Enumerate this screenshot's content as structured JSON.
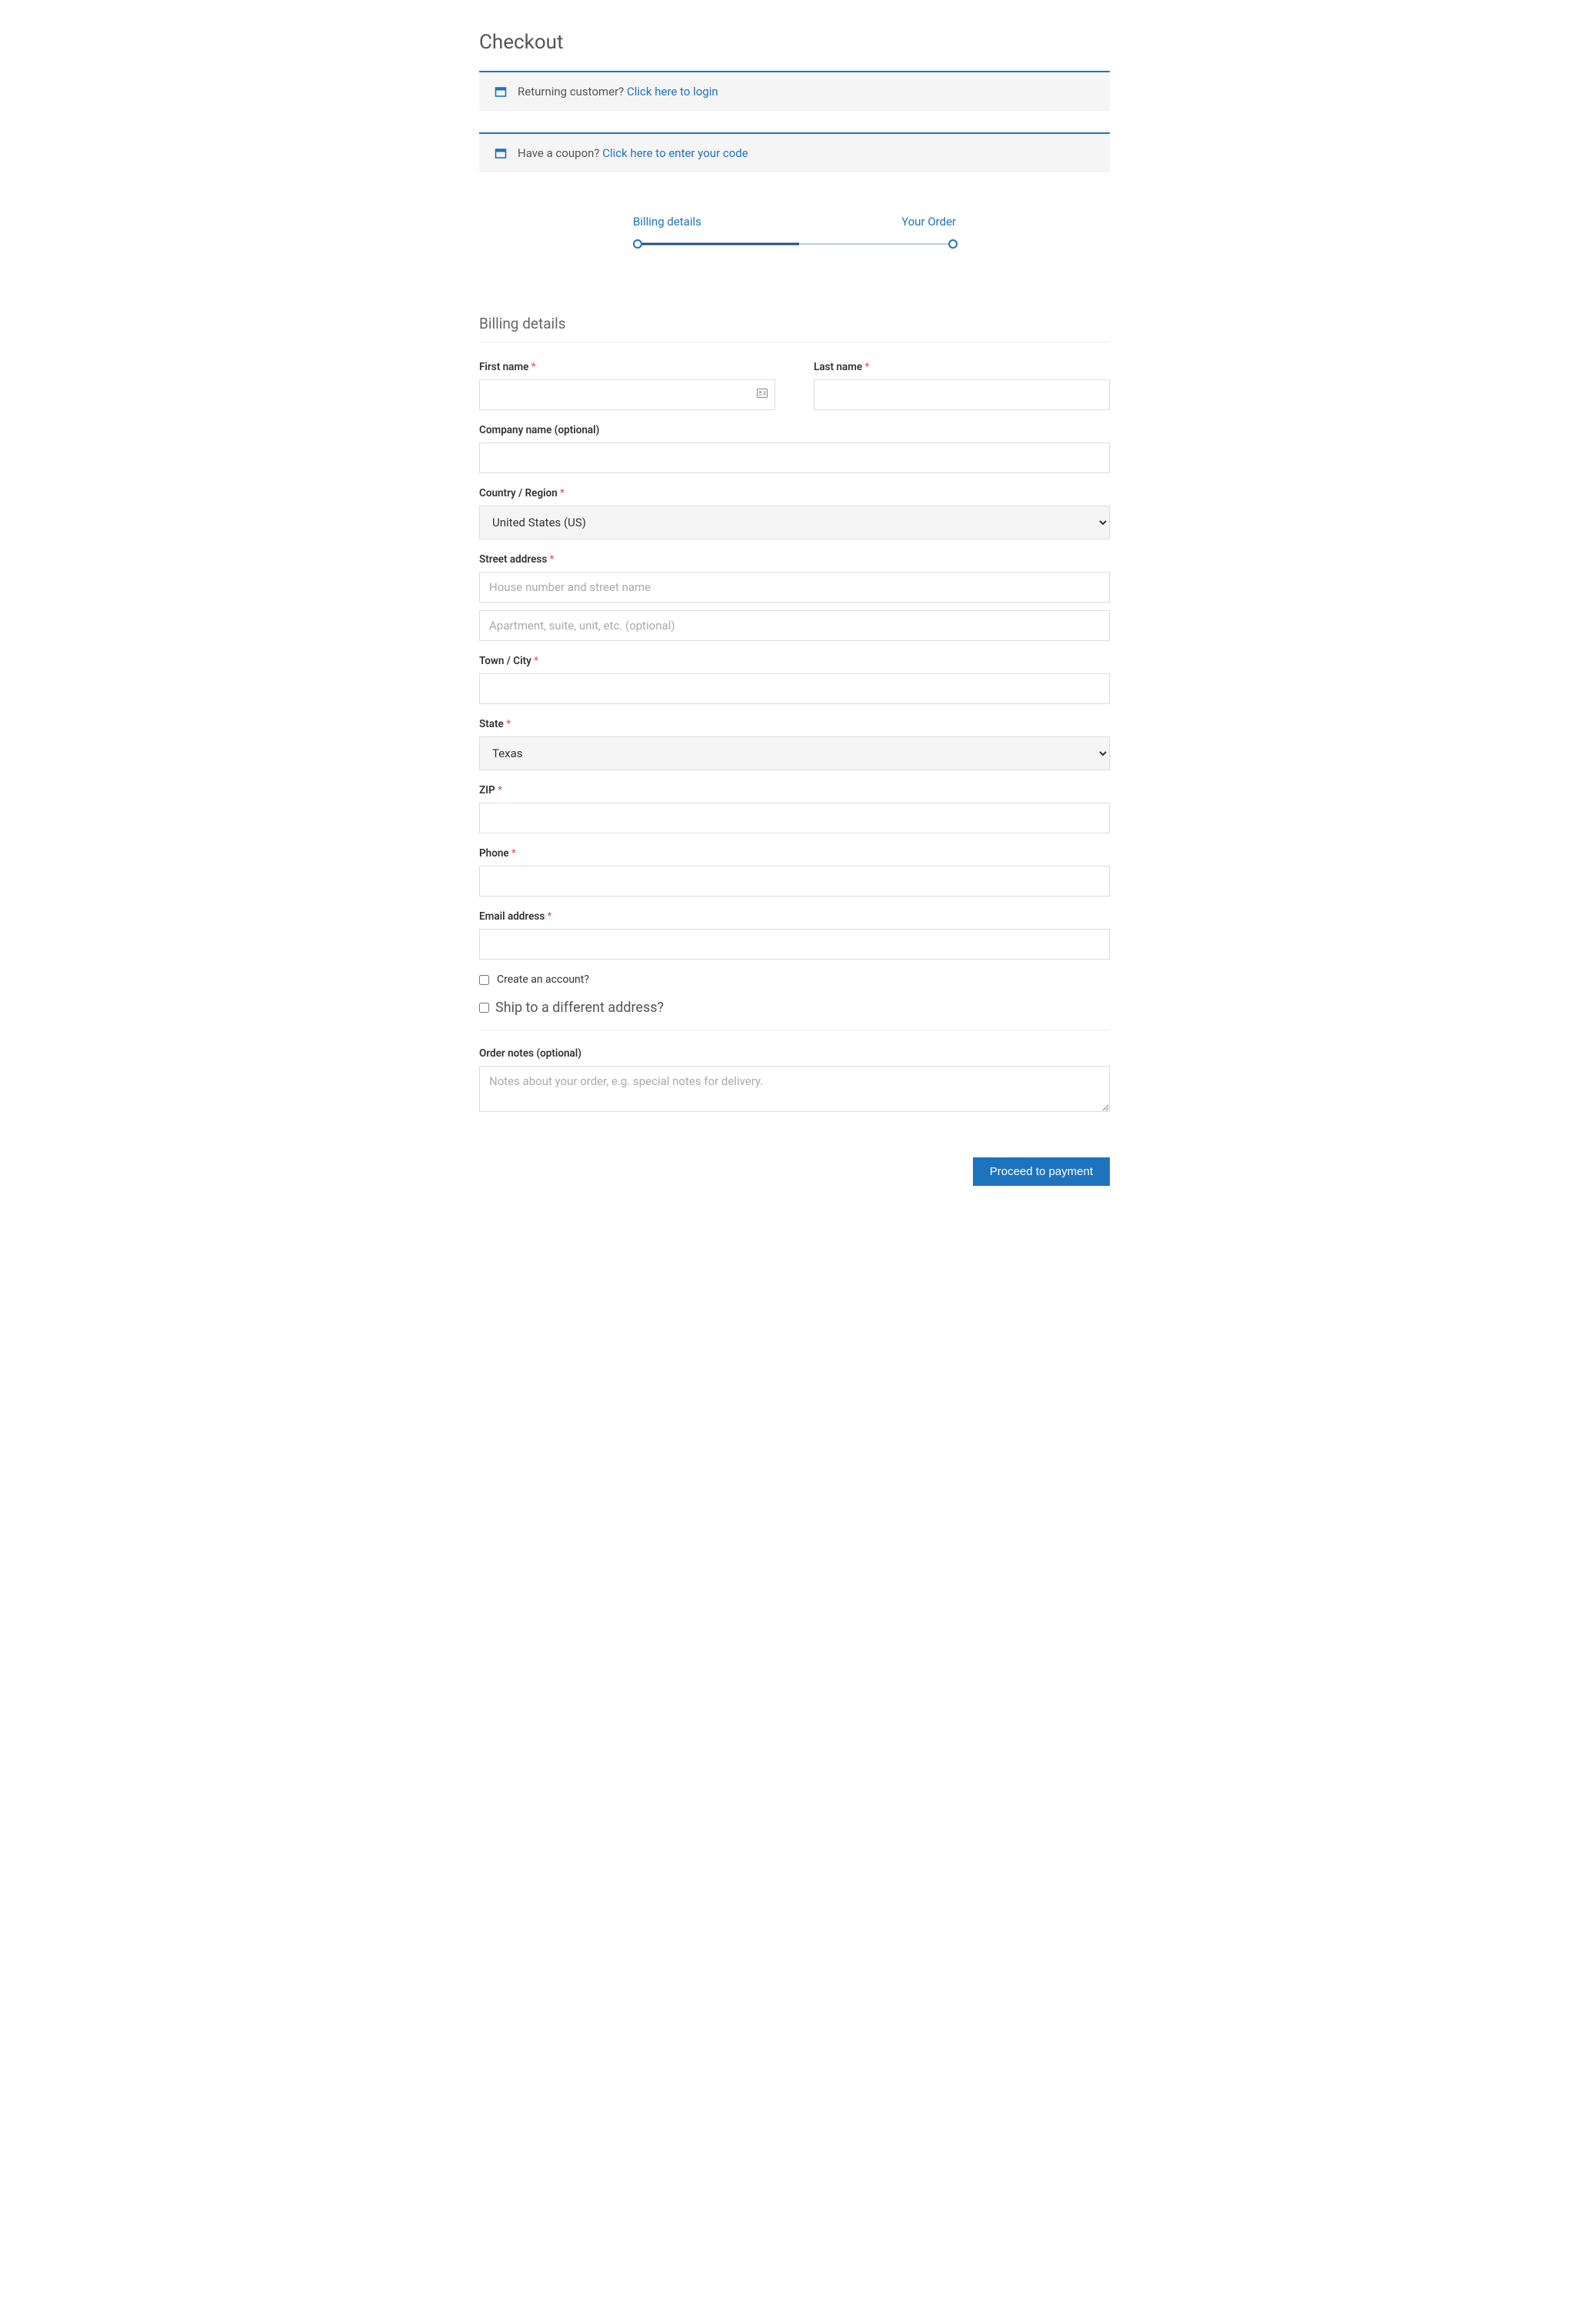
{
  "page": {
    "title": "Checkout"
  },
  "notices": {
    "returning": {
      "text": "Returning customer? ",
      "link": "Click here to login"
    },
    "coupon": {
      "text": "Have a coupon? ",
      "link": "Click here to enter your code"
    }
  },
  "progress": {
    "step1": "Billing details",
    "step2": "Your Order"
  },
  "billing": {
    "heading": "Billing details",
    "first_name_label": "First name",
    "last_name_label": "Last name",
    "company_label": "Company name (optional)",
    "country_label": "Country / Region",
    "country_value": "United States (US)",
    "street_label": "Street address",
    "street1_placeholder": "House number and street name",
    "street2_placeholder": "Apartment, suite, unit, etc. (optional)",
    "city_label": "Town / City",
    "state_label": "State",
    "state_value": "Texas",
    "zip_label": "ZIP",
    "phone_label": "Phone",
    "email_label": "Email address",
    "create_account_label": "Create an account?"
  },
  "shipping": {
    "diff_label": "Ship to a different address?"
  },
  "order": {
    "notes_label": "Order notes (optional)",
    "notes_placeholder": "Notes about your order, e.g. special notes for delivery."
  },
  "buttons": {
    "proceed": "Proceed to payment"
  }
}
